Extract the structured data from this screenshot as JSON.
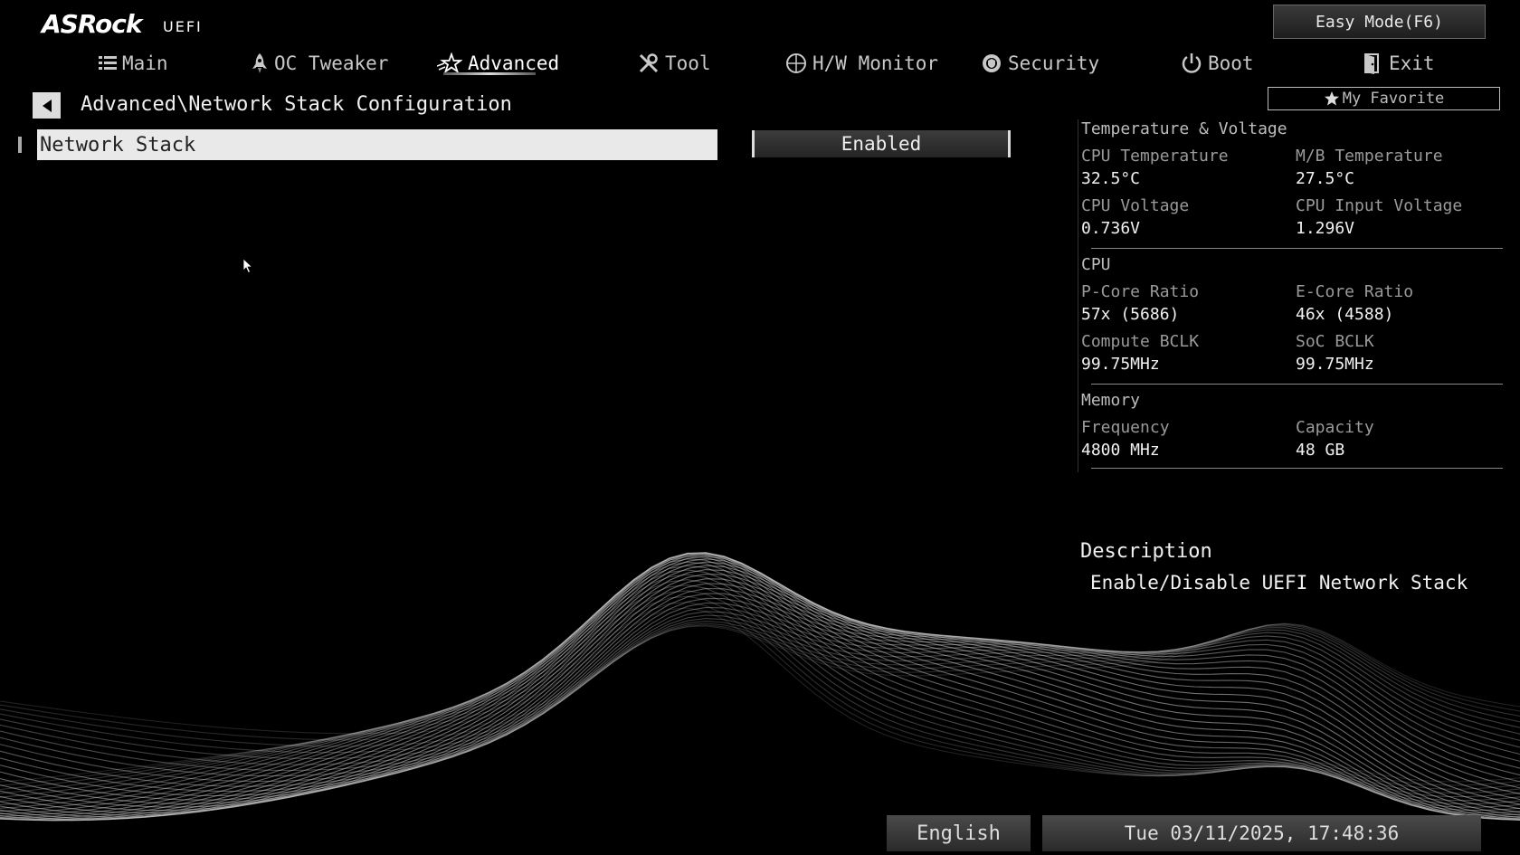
{
  "brand": {
    "logo": "ASRock",
    "sub": "UEFI"
  },
  "easy_mode": "Easy Mode(F6)",
  "nav": [
    {
      "id": "main",
      "label": "Main",
      "icon": "list-icon"
    },
    {
      "id": "oc",
      "label": "OC Tweaker",
      "icon": "rocket-icon"
    },
    {
      "id": "advanced",
      "label": "Advanced",
      "icon": "star-icon",
      "active": true
    },
    {
      "id": "tool",
      "label": "Tool",
      "icon": "wrench-icon"
    },
    {
      "id": "hw",
      "label": "H/W Monitor",
      "icon": "monitor-icon"
    },
    {
      "id": "security",
      "label": "Security",
      "icon": "shield-icon"
    },
    {
      "id": "boot",
      "label": "Boot",
      "icon": "power-icon"
    },
    {
      "id": "exit",
      "label": "Exit",
      "icon": "exit-icon"
    }
  ],
  "breadcrumb": "Advanced\\Network Stack Configuration",
  "favorite": "My Favorite",
  "setting": {
    "label": "Network Stack",
    "value": "Enabled"
  },
  "panel": {
    "temp_voltage": {
      "title": "Temperature & Voltage",
      "cpu_temp_label": "CPU Temperature",
      "cpu_temp": "32.5°C",
      "mb_temp_label": "M/B Temperature",
      "mb_temp": "27.5°C",
      "cpu_volt_label": "CPU Voltage",
      "cpu_volt": "0.736V",
      "cpu_input_label": "CPU Input Voltage",
      "cpu_input": "1.296V"
    },
    "cpu": {
      "title": "CPU",
      "pcore_label": "P-Core Ratio",
      "pcore": "57x (5686)",
      "ecore_label": "E-Core Ratio",
      "ecore": "46x (4588)",
      "compute_label": "Compute BCLK",
      "compute": "99.75MHz",
      "soc_label": "SoC BCLK",
      "soc": "99.75MHz"
    },
    "memory": {
      "title": "Memory",
      "freq_label": "Frequency",
      "freq": "4800 MHz",
      "cap_label": "Capacity",
      "cap": "48 GB"
    }
  },
  "description": {
    "title": "Description",
    "text": "Enable/Disable UEFI Network Stack"
  },
  "language": "English",
  "datetime": "Tue 03/11/2025, 17:48:36"
}
